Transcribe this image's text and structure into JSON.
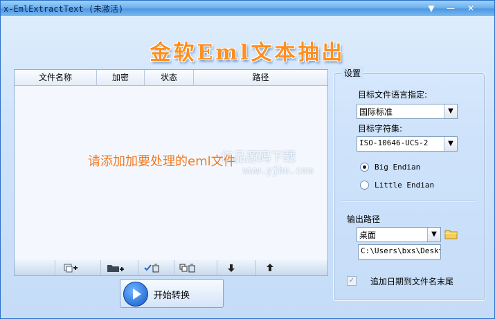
{
  "window": {
    "title": "x-EmlExtractText (未激活)",
    "controls": [
      "▼",
      "—",
      "✕"
    ]
  },
  "banner": {
    "text": "金软Eml文本抽出"
  },
  "file_list": {
    "columns": [
      "文件名称",
      "加密",
      "状态",
      "路径"
    ],
    "empty_hint": "请添加加要处理的eml文件",
    "watermark": "亿品源码下载",
    "watermark2": "www.yjbu.com"
  },
  "toolbar": {
    "buttons": [
      {
        "icon": "add-file-icon"
      },
      {
        "icon": "add-folder-icon"
      },
      {
        "icon": "delete-checked-icon"
      },
      {
        "icon": "delete-all-icon"
      },
      {
        "icon": "move-down-icon"
      },
      {
        "icon": "move-up-icon"
      }
    ]
  },
  "start_button": {
    "label": "开始转换"
  },
  "settings": {
    "title": "设置",
    "language_label": "目标文件语言指定:",
    "language_value": "国际标准",
    "charset_label": "目标字符集:",
    "charset_value": "ISO-10646-UCS-2",
    "endian_options": [
      {
        "label": "Big Endian",
        "selected": true
      },
      {
        "label": "Little Endian",
        "selected": false
      }
    ],
    "output_label": "输出路径",
    "output_value": "桌面",
    "output_path": "C:\\Users\\bxs\\Desktc",
    "append_date_label": "追加日期到文件名末尾",
    "append_date_checked": true
  },
  "colors": {
    "accent": "#4f98e3",
    "banner": "#ff8f1e",
    "hint": "#f47a20"
  }
}
